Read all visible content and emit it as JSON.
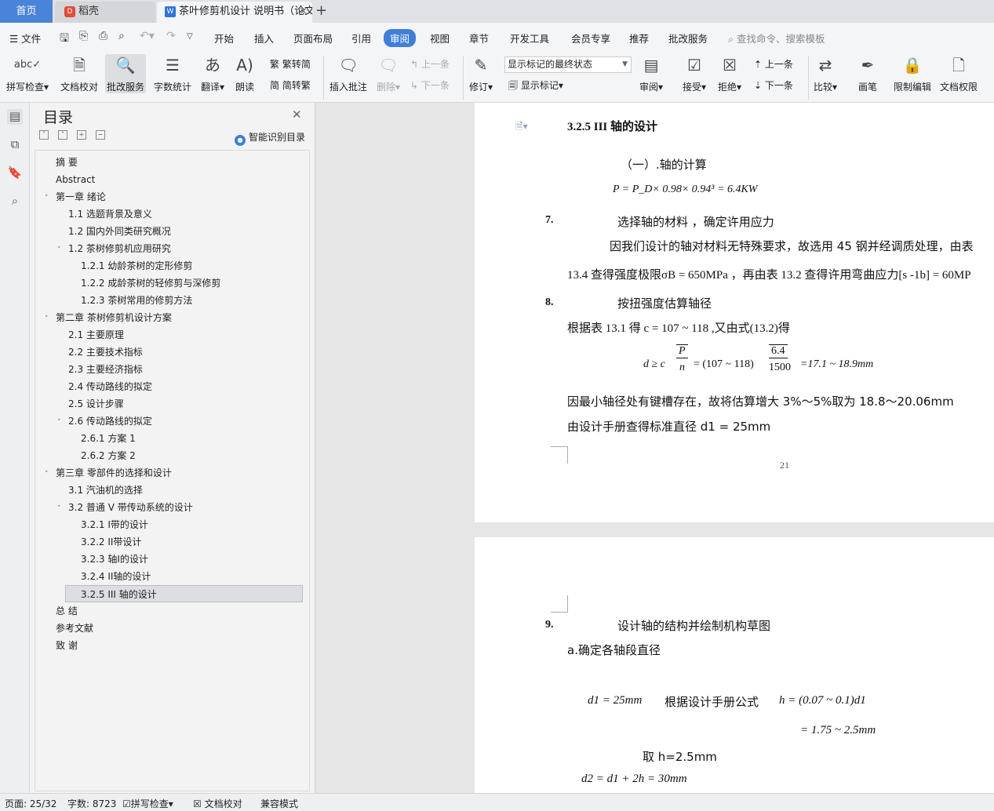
{
  "tabs": {
    "home": "首页",
    "daoke": "稻壳",
    "document": "茶叶修剪机设计 说明书（论文）"
  },
  "menu": {
    "file": "文件",
    "items": [
      "开始",
      "插入",
      "页面布局",
      "引用",
      "审阅",
      "视图",
      "章节",
      "开发工具",
      "会员专享",
      "推荐",
      "批改服务"
    ],
    "active": "审阅",
    "search_placeholder": "查找命令、搜索模板"
  },
  "ribbon": {
    "spell_check": "拼写检查",
    "doc_proof": "文档校对",
    "correction_service": "批改服务",
    "word_count": "字数统计",
    "translate": "翻译",
    "read_aloud": "朗读",
    "to_traditional": "繁转简",
    "to_simplified": "简转繁",
    "insert_comment": "插入批注",
    "delete": "删除",
    "prev_comment": "上一条",
    "next_comment": "下一条",
    "track_changes": "修订",
    "markup_mode": "显示标记的最终状态",
    "show_markup": "显示标记",
    "review": "审阅",
    "accept": "接受",
    "reject": "拒绝",
    "prev_change": "上一条",
    "next_change": "下一条",
    "compare": "比较",
    "pen": "画笔",
    "restrict_edit": "限制编辑",
    "doc_permission": "文档权限"
  },
  "nav": {
    "title": "目录",
    "smart_toc": "智能识别目录",
    "items": [
      {
        "label": "摘    要",
        "level": 0,
        "caret": ""
      },
      {
        "label": "Abstract",
        "level": 0,
        "caret": ""
      },
      {
        "label": "第一章  绪论",
        "level": 0,
        "caret": "v"
      },
      {
        "label": "1.1 选题背景及意义",
        "level": 1,
        "caret": ""
      },
      {
        "label": "1.2 国内外同类研究概况",
        "level": 1,
        "caret": ""
      },
      {
        "label": "1.2 茶树修剪机应用研究",
        "level": 1,
        "caret": "v"
      },
      {
        "label": "1.2.1 幼龄茶树的定形修剪",
        "level": 2,
        "caret": ""
      },
      {
        "label": "1.2.2 成龄茶树的轻修剪与深修剪",
        "level": 2,
        "caret": ""
      },
      {
        "label": "1.2.3 茶树常用的修剪方法",
        "level": 2,
        "caret": ""
      },
      {
        "label": "第二章  茶树修剪机设计方案",
        "level": 0,
        "caret": "v"
      },
      {
        "label": "2.1 主要原理",
        "level": 1,
        "caret": ""
      },
      {
        "label": "2.2 主要技术指标",
        "level": 1,
        "caret": ""
      },
      {
        "label": "2.3 主要经济指标",
        "level": 1,
        "caret": ""
      },
      {
        "label": "2.4 传动路线的拟定",
        "level": 1,
        "caret": ""
      },
      {
        "label": "2.5 设计步骤",
        "level": 1,
        "caret": ""
      },
      {
        "label": "2.6 传动路线的拟定",
        "level": 1,
        "caret": "v"
      },
      {
        "label": "2.6.1 方案 1",
        "level": 2,
        "caret": ""
      },
      {
        "label": "2.6.2 方案 2",
        "level": 2,
        "caret": ""
      },
      {
        "label": "第三章  零部件的选择和设计",
        "level": 0,
        "caret": "v"
      },
      {
        "label": "3.1 汽油机的选择",
        "level": 1,
        "caret": ""
      },
      {
        "label": "3.2 普通 V 带传动系统的设计",
        "level": 1,
        "caret": "v"
      },
      {
        "label": "3.2.1 I带的设计",
        "level": 2,
        "caret": ""
      },
      {
        "label": "3.2.2 II带设计",
        "level": 2,
        "caret": ""
      },
      {
        "label": "3.2.3 轴I的设计",
        "level": 2,
        "caret": ""
      },
      {
        "label": "3.2.4 II轴的设计",
        "level": 2,
        "caret": ""
      },
      {
        "label": "3.2.5 III  轴的设计",
        "level": 2,
        "caret": "",
        "selected": true
      },
      {
        "label": "总    结",
        "level": 0,
        "caret": ""
      },
      {
        "label": "参考文献",
        "level": 0,
        "caret": ""
      },
      {
        "label": "致    谢",
        "level": 0,
        "caret": ""
      }
    ]
  },
  "doc": {
    "heading": "3.2.5 III  轴的设计",
    "sub1": "（一）.轴的计算",
    "formula_p": "P = P_D× 0.98× 0.94³ = 6.4KW",
    "item7_num": "7.",
    "item7_text": "选择轴的材料 ，确定许用应力",
    "para1": "因我们设计的轴对材料无特殊要求，故选用 45 钢并经调质处理，由表",
    "para2": "13.4 查得强度极限σB = 650MPa ，再由表 13.2 查得许用弯曲应力[s -1b] = 60MP",
    "item8_num": "8.",
    "item8_text": "按扭强度估算轴径",
    "para3": "根据表 13.1 得 c = 107 ~ 118 ,又由式(13.2)得",
    "formula_d_left": "d ≥ c",
    "formula_d_frac_top": "P",
    "formula_d_frac_bot": "n",
    "formula_d_mid": "= (107 ~ 118)",
    "formula_d_num_top": "6.4",
    "formula_d_num_bot": "1500",
    "formula_d_right": "=17.1 ~ 18.9mm",
    "para4": "因最小轴径处有键槽存在，故将估算增大 3%～5%取为 18.8～20.06mm",
    "para5": "由设计手册查得标准直径 d1 = 25mm",
    "page_number": "21",
    "item9_num": "9.",
    "item9_text": "设计轴的结构并绘制机构草图",
    "sub_a": "a.确定各轴段直径",
    "d1_line_left": "d1 = 25mm",
    "d1_line_mid": "根据设计手册公式",
    "d1_line_right": "h = (0.07 ~ 0.1)d1",
    "h_result": "= 1.75 ~ 2.5mm",
    "take_h": "取 h=2.5mm",
    "d2_line": "d2 = d1 + 2h = 30mm"
  },
  "status": {
    "page": "页面: 25/32",
    "words": "字数: 8723",
    "spell": "拼写检查",
    "proof": "文档校对",
    "compat": "兼容模式"
  },
  "colors": {
    "accent": "#3f7fd9",
    "home_tab": "#4a84d8",
    "daoke_logo": "#e24a3b"
  }
}
